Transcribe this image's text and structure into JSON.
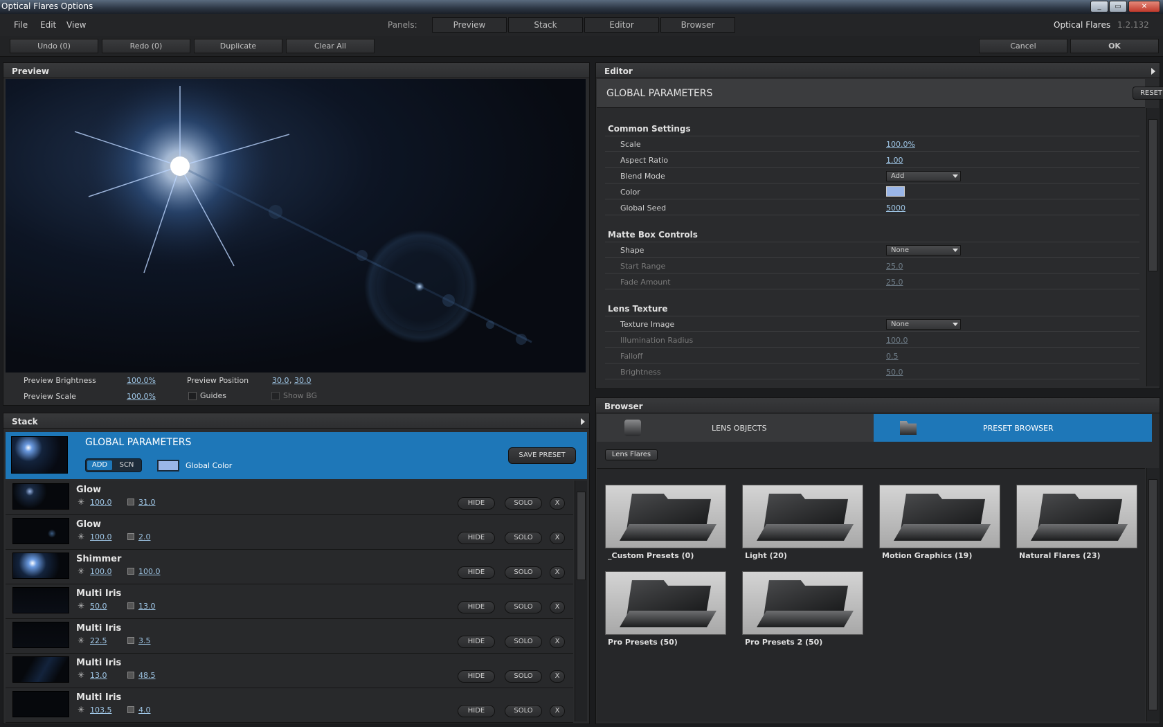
{
  "window": {
    "title": "Optical Flares Options",
    "minimize": "_",
    "restore": "▭",
    "close": "✕"
  },
  "menu": {
    "file": "File",
    "edit": "Edit",
    "view": "View",
    "panels_label": "Panels:",
    "panels": [
      "Preview",
      "Stack",
      "Editor",
      "Browser"
    ],
    "app_name": "Optical Flares",
    "version": "1.2.132"
  },
  "actions": {
    "undo": "Undo (0)",
    "redo": "Redo (0)",
    "duplicate": "Duplicate",
    "clear_all": "Clear All",
    "cancel": "Cancel",
    "ok": "OK"
  },
  "preview": {
    "title": "Preview",
    "brightness_label": "Preview Brightness",
    "brightness_value": "100.0%",
    "scale_label": "Preview Scale",
    "scale_value": "100.0%",
    "position_label": "Preview Position",
    "position_x": "30.0",
    "position_sep": ",",
    "position_y": "30.0",
    "guides_label": "Guides",
    "showbg_label": "Show BG"
  },
  "stack": {
    "title": "Stack",
    "global": {
      "name": "GLOBAL PARAMETERS",
      "mode_add": "ADD",
      "mode_scn": "SCN",
      "global_color_label": "Global Color",
      "save_preset": "SAVE PRESET"
    },
    "hide_label": "HIDE",
    "solo_label": "SOLO",
    "remove_label": "X",
    "rows": [
      {
        "name": "Glow",
        "brightness": "100.0",
        "size": "31.0"
      },
      {
        "name": "Glow",
        "brightness": "100.0",
        "size": "2.0"
      },
      {
        "name": "Shimmer",
        "brightness": "100.0",
        "size": "100.0"
      },
      {
        "name": "Multi Iris",
        "brightness": "50.0",
        "size": "13.0"
      },
      {
        "name": "Multi Iris",
        "brightness": "22.5",
        "size": "3.5"
      },
      {
        "name": "Multi Iris",
        "brightness": "13.0",
        "size": "48.5"
      },
      {
        "name": "Multi Iris",
        "brightness": "103.5",
        "size": "4.0"
      }
    ]
  },
  "editor": {
    "title": "Editor",
    "heading": "GLOBAL PARAMETERS",
    "reset": "RESET",
    "common": {
      "title": "Common Settings",
      "scale_label": "Scale",
      "scale_value": "100.0%",
      "aspect_label": "Aspect Ratio",
      "aspect_value": "1.00",
      "blend_label": "Blend Mode",
      "blend_value": "Add",
      "color_label": "Color",
      "seed_label": "Global Seed",
      "seed_value": "5000"
    },
    "matte": {
      "title": "Matte Box Controls",
      "shape_label": "Shape",
      "shape_value": "None",
      "start_label": "Start Range",
      "start_value": "25.0",
      "fade_label": "Fade Amount",
      "fade_value": "25.0"
    },
    "texture": {
      "title": "Lens Texture",
      "image_label": "Texture Image",
      "image_value": "None",
      "radius_label": "Illumination Radius",
      "radius_value": "100.0",
      "falloff_label": "Falloff",
      "falloff_value": "0.5",
      "brightness_label": "Brightness",
      "brightness_value": "50.0"
    }
  },
  "browser": {
    "title": "Browser",
    "tab_lens": "LENS OBJECTS",
    "tab_preset": "PRESET BROWSER",
    "breadcrumb": "Lens Flares",
    "folders": [
      "_Custom Presets (0)",
      "Light (20)",
      "Motion Graphics (19)",
      "Natural Flares (23)",
      "Pro Presets (50)",
      "Pro Presets 2 (50)"
    ]
  },
  "colors": {
    "accent": "#1e77b8",
    "swatch": "#9ab6e8",
    "link": "#9fc6e6"
  }
}
